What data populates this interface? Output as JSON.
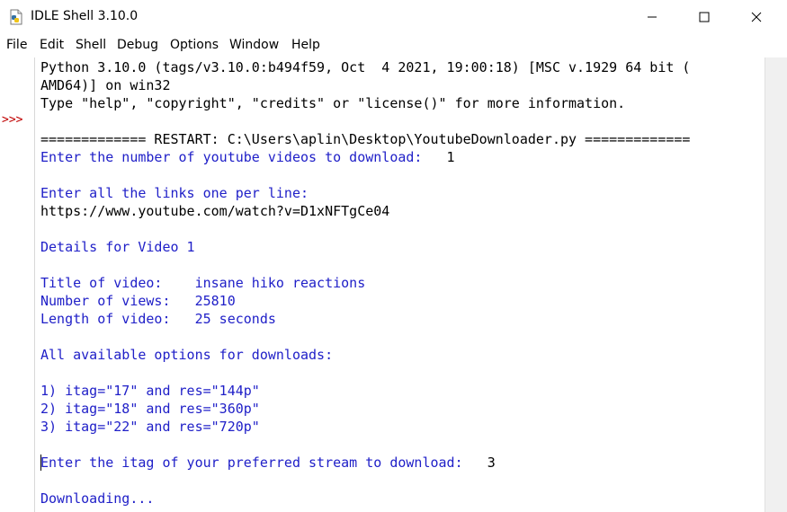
{
  "window": {
    "title": "IDLE Shell 3.10.0",
    "controls": {
      "minimize": "—",
      "maximize": "☐",
      "close": "✕"
    }
  },
  "menu": [
    "File",
    "Edit",
    "Shell",
    "Debug",
    "Options",
    "Window",
    "Help"
  ],
  "shell": {
    "prompt": ">>>",
    "banner": [
      "Python 3.10.0 (tags/v3.10.0:b494f59, Oct  4 2021, 19:00:18) [MSC v.1929 64 bit (",
      "AMD64)] on win32",
      "Type \"help\", \"copyright\", \"credits\" or \"license()\" for more information."
    ],
    "restart": "============= RESTART: C:\\Users\\aplin\\Desktop\\YoutubeDownloader.py =============",
    "q_count": "Enter the number of youtube videos to download:   ",
    "a_count": "1",
    "q_links": "Enter all the links one per line:",
    "a_link": "https://www.youtube.com/watch?v=D1xNFTgCe04",
    "details": "Details for Video 1",
    "title_line": "Title of video:    insane hiko reactions",
    "views_line": "Number of views:   25810",
    "length_line": "Length of video:   25 seconds",
    "options_header": "All available options for downloads:",
    "options": [
      "1) itag=\"17\" and res=\"144p\"",
      "2) itag=\"18\" and res=\"360p\"",
      "3) itag=\"22\" and res=\"720p\""
    ],
    "q_itag": "Enter the itag of your preferred stream to download:   ",
    "a_itag": "3",
    "downloading": "Downloading..."
  },
  "colors": {
    "output": "#2020c8",
    "prompt": "#c00000",
    "input": "#000000"
  }
}
